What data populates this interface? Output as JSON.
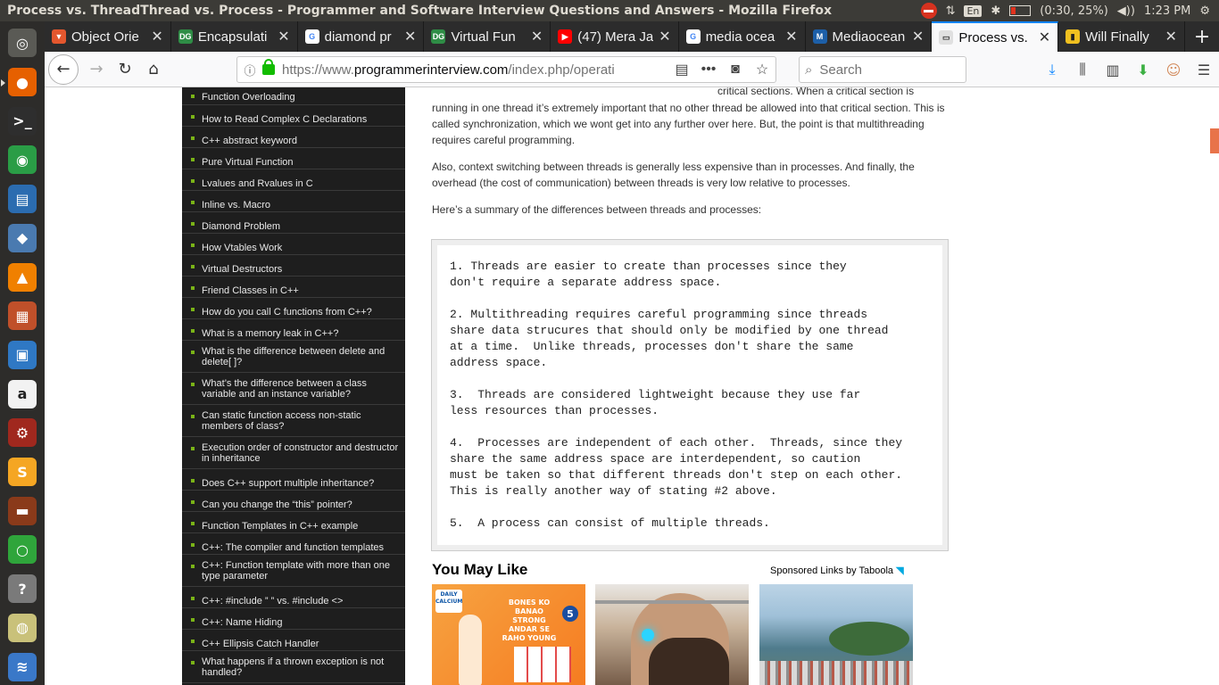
{
  "window": {
    "title": "Process vs. ThreadThread vs. Process - Programmer and Software Interview Questions and Answers - Mozilla Firefox"
  },
  "tray": {
    "lang": "En",
    "battery": "(0:30, 25%)",
    "time": "1:23 PM"
  },
  "launcher": [
    {
      "name": "dash-icon",
      "glyph": "◎",
      "bg": "#5a5a55"
    },
    {
      "name": "firefox-icon",
      "glyph": "●",
      "bg": "#e66000"
    },
    {
      "name": "terminal-icon",
      "glyph": ">_",
      "bg": "#2e2e2e"
    },
    {
      "name": "chrome-icon",
      "glyph": "◉",
      "bg": "#2a9d46"
    },
    {
      "name": "writer-icon",
      "glyph": "▤",
      "bg": "#2b6cb0"
    },
    {
      "name": "sublime-drop-icon",
      "glyph": "◆",
      "bg": "#4a7ab0"
    },
    {
      "name": "vlc-icon",
      "glyph": "▲",
      "bg": "#f08000"
    },
    {
      "name": "impress-icon",
      "glyph": "▦",
      "bg": "#c0502a"
    },
    {
      "name": "virtualbox-icon",
      "glyph": "▣",
      "bg": "#2f78c4"
    },
    {
      "name": "amazon-icon",
      "glyph": "a",
      "bg": "#f2f2f2"
    },
    {
      "name": "settings-icon",
      "glyph": "⚙",
      "bg": "#a0281e"
    },
    {
      "name": "sublime-text-icon",
      "glyph": "S",
      "bg": "#f5a623"
    },
    {
      "name": "file-manager-icon",
      "glyph": "▬",
      "bg": "#8a3a1a"
    },
    {
      "name": "refresh-app-icon",
      "glyph": "○",
      "bg": "#2fa53b"
    },
    {
      "name": "help-icon",
      "glyph": "?",
      "bg": "#7a7a7a"
    },
    {
      "name": "audio-icon",
      "glyph": "◍",
      "bg": "#c9c17a"
    },
    {
      "name": "monitor-icon",
      "glyph": "≋",
      "bg": "#3a78c8"
    }
  ],
  "tabs": [
    {
      "label": "Object Orie",
      "fav_glyph": "▼",
      "fav_bg": "#e4572e",
      "fav_fg": "#fff"
    },
    {
      "label": "Encapsulati",
      "fav_glyph": "DG",
      "fav_bg": "#2f8d46",
      "fav_fg": "#fff"
    },
    {
      "label": "diamond pr",
      "fav_glyph": "G",
      "fav_bg": "#ffffff",
      "fav_fg": "#4285f4"
    },
    {
      "label": "Virtual Fun",
      "fav_glyph": "DG",
      "fav_bg": "#2f8d46",
      "fav_fg": "#fff"
    },
    {
      "label": "(47) Mera Ja",
      "fav_glyph": "▶",
      "fav_bg": "#ff0000",
      "fav_fg": "#fff"
    },
    {
      "label": "media ocea",
      "fav_glyph": "G",
      "fav_bg": "#ffffff",
      "fav_fg": "#4285f4"
    },
    {
      "label": "Mediaocean",
      "fav_glyph": "M",
      "fav_bg": "#1d5fa8",
      "fav_fg": "#fff"
    },
    {
      "label": "Process vs.",
      "fav_glyph": "▭",
      "fav_bg": "#e0e0e0",
      "fav_fg": "#333",
      "active": true
    },
    {
      "label": "Will Finally",
      "fav_glyph": "▮",
      "fav_bg": "#f0c020",
      "fav_fg": "#222"
    }
  ],
  "nav": {
    "url_prefix": "https://www.",
    "url_domain": "programmerinterview.com",
    "url_rest": "/index.php/operati",
    "search_placeholder": "Search"
  },
  "sidebar": [
    {
      "label": "Function Overloading",
      "kind": "first"
    },
    {
      "label": "How to Read Complex C Declarations",
      "kind": "single"
    },
    {
      "label": "C++ abstract keyword",
      "kind": "single"
    },
    {
      "label": "Pure Virtual Function",
      "kind": "single"
    },
    {
      "label": "Lvalues and Rvalues in C",
      "kind": "single"
    },
    {
      "label": "Inline vs. Macro",
      "kind": "single"
    },
    {
      "label": "Diamond Problem",
      "kind": "single"
    },
    {
      "label": "How Vtables Work",
      "kind": "single"
    },
    {
      "label": "Virtual Destructors",
      "kind": "single"
    },
    {
      "label": "Friend Classes in C++",
      "kind": "single"
    },
    {
      "label": "How do you call C functions from C++?",
      "kind": "single"
    },
    {
      "label": "What is a memory leak in C++?",
      "kind": "single"
    },
    {
      "label": "What is the difference between delete and delete[ ]?",
      "kind": "double"
    },
    {
      "label": "What’s the difference between a class variable and an instance variable?",
      "kind": "double"
    },
    {
      "label": "Can static function access non-static members of class?",
      "kind": "double"
    },
    {
      "label": "Execution order of constructor and destructor in inheritance",
      "kind": "double"
    },
    {
      "label": "Does C++ support multiple inheritance?",
      "kind": "single"
    },
    {
      "label": "Can you change the “this” pointer?",
      "kind": "single"
    },
    {
      "label": "Function Templates in C++ example",
      "kind": "single"
    },
    {
      "label": "C++: The compiler and function templates",
      "kind": "single"
    },
    {
      "label": "C++: Function template with more than one type parameter",
      "kind": "double"
    },
    {
      "label": "C++: #include ” ” vs. #include <>",
      "kind": "single"
    },
    {
      "label": "C++: Name Hiding",
      "kind": "single"
    },
    {
      "label": "C++ Ellipsis Catch Handler",
      "kind": "single"
    },
    {
      "label": "What happens if a thrown exception is not handled?",
      "kind": "double"
    }
  ],
  "article": {
    "cut_text": "critical sections. When a critical section is",
    "para1": "running in one thread it’s extremely important that no other thread be allowed into that critical section. This is called synchronization, which we wont get into any further over here. But, the point is that multithreading requires careful programming.",
    "para2": "Also, context switching between threads is generally less expensive than in processes. And finally, the overhead (the cost of communication) between threads is very low relative to processes.",
    "para3": "Here’s a summary of the differences between threads and processes:",
    "code": "1. Threads are easier to create than processes since they\ndon't require a separate address space.\n\n2. Multithreading requires careful programming since threads\nshare data strucures that should only be modified by one thread\nat a time.  Unlike threads, processes don't share the same\naddress space.\n\n3.  Threads are considered lightweight because they use far\nless resources than processes.\n\n4.  Processes are independent of each other.  Threads, since they\nshare the same address space are interdependent, so caution\nmust be taken so that different threads don't step on each other.\nThis is really another way of stating #2 above.\n\n5.  A process can consist of multiple threads."
  },
  "recommend": {
    "heading": "You May Like",
    "sponsor": "Sponsored Links by Taboola",
    "ad1_badge": "DAILY CALCIUM",
    "ad1_slogan": "BONES KO BANAO STRONG ANDAR SE RAHO YOUNG",
    "ad1_number": "5"
  },
  "colors": {
    "active_tab_accent": "#0a84ff",
    "sidebar_bg": "#1e1e1e",
    "bullet": "#7ab317",
    "lock": "#12bc00"
  }
}
